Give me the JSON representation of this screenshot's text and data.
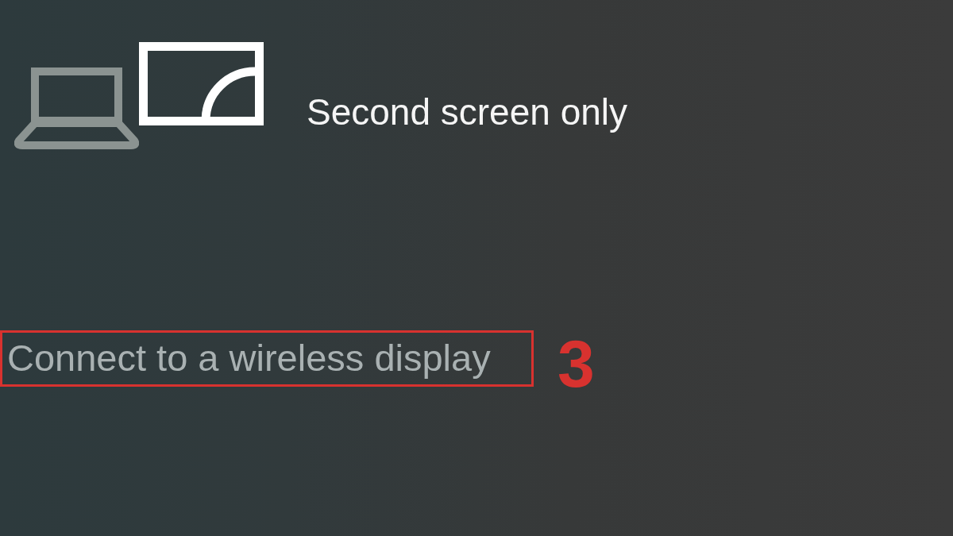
{
  "projection_option": {
    "label": "Second screen only"
  },
  "wireless_link": {
    "label": "Connect to a wireless display",
    "highlighted": true
  },
  "step_marker": "3"
}
